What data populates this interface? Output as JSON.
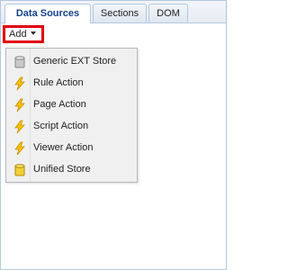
{
  "tabs": [
    {
      "label": "Data Sources",
      "active": true
    },
    {
      "label": "Sections",
      "active": false
    },
    {
      "label": "DOM",
      "active": false
    }
  ],
  "toolbar": {
    "add_label": "Add"
  },
  "menu": {
    "items": [
      {
        "label": "Generic EXT Store",
        "icon": "store-grey-icon"
      },
      {
        "label": "Rule Action",
        "icon": "lightning-icon"
      },
      {
        "label": "Page Action",
        "icon": "lightning-icon"
      },
      {
        "label": "Script Action",
        "icon": "lightning-icon"
      },
      {
        "label": "Viewer Action",
        "icon": "lightning-icon"
      },
      {
        "label": "Unified Store",
        "icon": "store-yellow-icon"
      }
    ]
  },
  "colors": {
    "highlight_border": "#e0000b",
    "lightning": "#f5c400",
    "store_yellow": "#f2d03a",
    "store_grey": "#c9c9c9"
  }
}
